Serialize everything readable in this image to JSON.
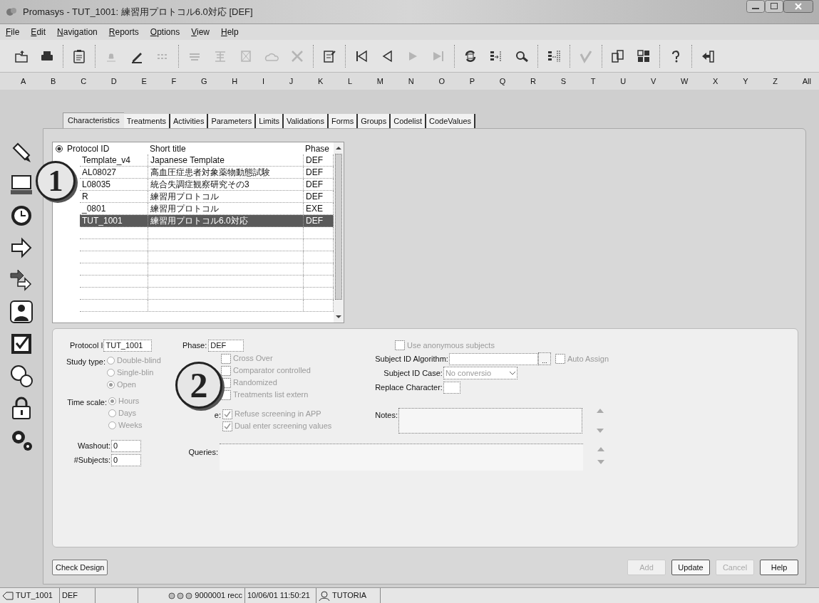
{
  "window": {
    "title": "Promasys - TUT_1001: 練習用プロトコル6.0対応 [DEF]"
  },
  "menu": [
    "File",
    "Edit",
    "Navigation",
    "Reports",
    "Options",
    "View",
    "Help"
  ],
  "toolbar": [
    [
      {
        "disabled": false
      },
      {
        "disabled": false
      }
    ],
    [
      {
        "disabled": false
      }
    ],
    [
      {
        "disabled": true
      },
      {
        "disabled": false
      },
      {
        "disabled": true
      }
    ],
    [
      {
        "disabled": true
      },
      {
        "disabled": true
      },
      {
        "disabled": true
      },
      {
        "disabled": true
      },
      {
        "disabled": true
      }
    ],
    [
      {
        "disabled": false
      }
    ],
    [
      {
        "disabled": false
      },
      {
        "disabled": false
      },
      {
        "disabled": true
      },
      {
        "disabled": true
      }
    ],
    [
      {
        "disabled": false
      },
      {
        "disabled": false
      },
      {
        "disabled": false
      }
    ],
    [
      {
        "disabled": false
      }
    ],
    [
      {
        "disabled": true
      }
    ],
    [
      {
        "disabled": false
      },
      {
        "disabled": false
      }
    ],
    [
      {
        "disabled": false
      }
    ],
    [
      {
        "disabled": false
      }
    ]
  ],
  "alphabet": [
    "A",
    "B",
    "C",
    "D",
    "E",
    "F",
    "G",
    "H",
    "I",
    "J",
    "K",
    "L",
    "M",
    "N",
    "O",
    "P",
    "Q",
    "R",
    "S",
    "T",
    "U",
    "V",
    "W",
    "X",
    "Y",
    "Z",
    "All"
  ],
  "tabs": [
    {
      "label": "Characteristics",
      "selected": true
    },
    {
      "label": "Treatments",
      "selected": false
    },
    {
      "label": "Activities",
      "selected": false
    },
    {
      "label": "Parameters",
      "selected": false
    },
    {
      "label": "Limits",
      "selected": false
    },
    {
      "label": "Validations",
      "selected": false
    },
    {
      "label": "Forms",
      "selected": false
    },
    {
      "label": "Groups",
      "selected": false
    },
    {
      "label": "Codelist",
      "selected": false
    },
    {
      "label": "CodeValues",
      "selected": false
    }
  ],
  "callouts": [
    "1",
    "2"
  ],
  "table": {
    "columns": [
      "Protocol ID",
      "Short title",
      "Phase"
    ],
    "rows": [
      {
        "cells": [
          "Template_v4",
          "Japanese Template",
          "DEF"
        ],
        "selected": false
      },
      {
        "cells": [
          "AL08027",
          "高血圧症患者対象薬物動態試験",
          "DEF"
        ],
        "selected": false
      },
      {
        "cells": [
          "L08035",
          "統合失調症観察研究その3",
          "DEF"
        ],
        "selected": false
      },
      {
        "cells": [
          "R",
          "練習用プロトコル",
          "DEF"
        ],
        "selected": false
      },
      {
        "cells": [
          "_0801",
          "練習用プロトコル",
          "EXE"
        ],
        "selected": false
      },
      {
        "cells": [
          "TUT_1001",
          "練習用プロトコル6.0対応",
          "DEF"
        ],
        "selected": true
      }
    ]
  },
  "form": {
    "protocol_id": {
      "label": "Protocol I",
      "value": "TUT_1001"
    },
    "phase": {
      "label": "Phase:",
      "value": "DEF"
    },
    "study_type": {
      "label": "Study type:",
      "options": [
        {
          "label": "Double-blind",
          "selected": false
        },
        {
          "label": "Single-blin",
          "selected": false
        },
        {
          "label": "Open",
          "selected": true
        }
      ]
    },
    "time_scale": {
      "label": "Time scale:",
      "options": [
        {
          "label": "Hours",
          "selected": true
        },
        {
          "label": "Days",
          "selected": false
        },
        {
          "label": "Weeks",
          "selected": false
        }
      ]
    },
    "washout": {
      "label": "Washout:",
      "value": "0"
    },
    "subjects": {
      "label": "#Subjects:",
      "value": "0"
    },
    "options": [
      {
        "label": "Cross Over",
        "checked": false
      },
      {
        "label": "Comparator controlled",
        "checked": false
      },
      {
        "label": "Randomized",
        "checked": false
      },
      {
        "label": "Treatments list extern",
        "checked": false
      }
    ],
    "screening_label": "e:",
    "screening": [
      {
        "label": "Refuse screening in APP",
        "checked": true
      },
      {
        "label": "Dual enter screening values",
        "checked": true
      }
    ],
    "anonymous": {
      "label": "Use anonymous subjects",
      "checked": false
    },
    "algorithm": {
      "label": "Subject ID Algorithm:",
      "browse": "...",
      "auto_assign": {
        "label": "Auto Assign",
        "checked": false
      }
    },
    "id_case": {
      "label": "Subject ID Case:",
      "value": "No conversio"
    },
    "replace": {
      "label": "Replace Character:"
    },
    "notes": {
      "label": "Notes:"
    },
    "queries": {
      "label": "Queries:"
    }
  },
  "buttons": {
    "check_design": "Check Design",
    "actions": [
      {
        "label": "Add",
        "disabled": true
      },
      {
        "label": "Update",
        "disabled": false
      },
      {
        "label": "Cancel",
        "disabled": true
      },
      {
        "label": "Help",
        "disabled": false
      }
    ]
  },
  "status_bar": {
    "protocol": "TUT_1001",
    "phase": "DEF",
    "records": "9000001 recc",
    "datetime": "10/06/01 11:50:21",
    "user": "TUTORIA"
  }
}
